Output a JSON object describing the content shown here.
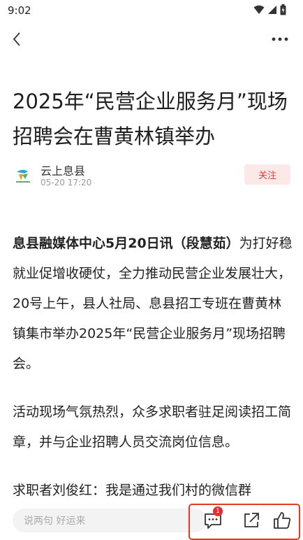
{
  "status_bar": {
    "time": "9:02"
  },
  "article": {
    "title": "2025年“民营企业服务月”现场招聘会在曹黄林镇举办",
    "author": "云上息县",
    "publish_time": "05-20 17:20",
    "follow_label": "关注",
    "paragraphs": [
      {
        "lead": "息县融媒体中心5月20日讯（段慧茹）",
        "text": "为打好稳就业促增收硬仗，全力推动民营企业发展壮大，20号上午，县人社局、息县招工专班在曹黄林镇集市举办2025年“民营企业服务月”现场招聘会。"
      },
      {
        "lead": "",
        "text": "活动现场气氛热烈，众多求职者驻足阅读招工简章，并与企业招聘人员交流岗位信息。"
      },
      {
        "lead": "",
        "text": "求职者刘俊红：我是通过我们村的微信群"
      }
    ]
  },
  "bottom_bar": {
    "comment_placeholder": "说两句 好运来",
    "comment_count": "1"
  },
  "icons": [
    "back-icon",
    "more-icon",
    "comment-icon",
    "share-icon",
    "like-icon",
    "wifi-icon",
    "signal-icon",
    "battery-icon"
  ],
  "colors": {
    "accent": "#e23b3b",
    "highlight_frame": "#e03a26"
  }
}
